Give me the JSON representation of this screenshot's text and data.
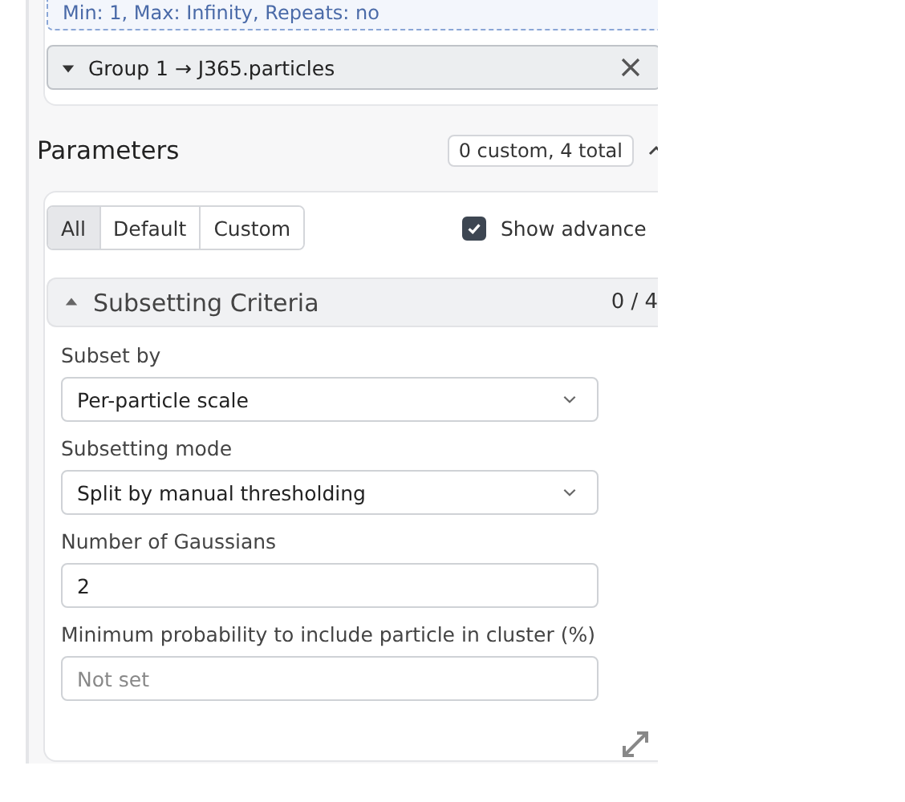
{
  "input_info": {
    "text": "Min: 1, Max: Infinity, Repeats: no"
  },
  "group_chip": {
    "label": "Group 1 → J365.particles",
    "expanded": false
  },
  "parameters": {
    "title": "Parameters",
    "summary": "0 custom, 4 total",
    "collapsed": false
  },
  "filter_tabs": [
    {
      "label": "All",
      "selected": true
    },
    {
      "label": "Default",
      "selected": false
    },
    {
      "label": "Custom",
      "selected": false
    }
  ],
  "show_advanced": {
    "label": "Show advance",
    "checked": true
  },
  "section": {
    "title": "Subsetting Criteria",
    "count": "0 / 4",
    "expanded": true
  },
  "fields": [
    {
      "kind": "select",
      "label": "Subset by",
      "value": "Per-particle scale"
    },
    {
      "kind": "select",
      "label": "Subsetting mode",
      "value": "Split by manual thresholding"
    },
    {
      "kind": "input",
      "label": "Number of Gaussians",
      "value": "2"
    },
    {
      "kind": "input",
      "label": "Minimum probability to include particle in cluster (%)",
      "placeholder": "Not set"
    }
  ]
}
